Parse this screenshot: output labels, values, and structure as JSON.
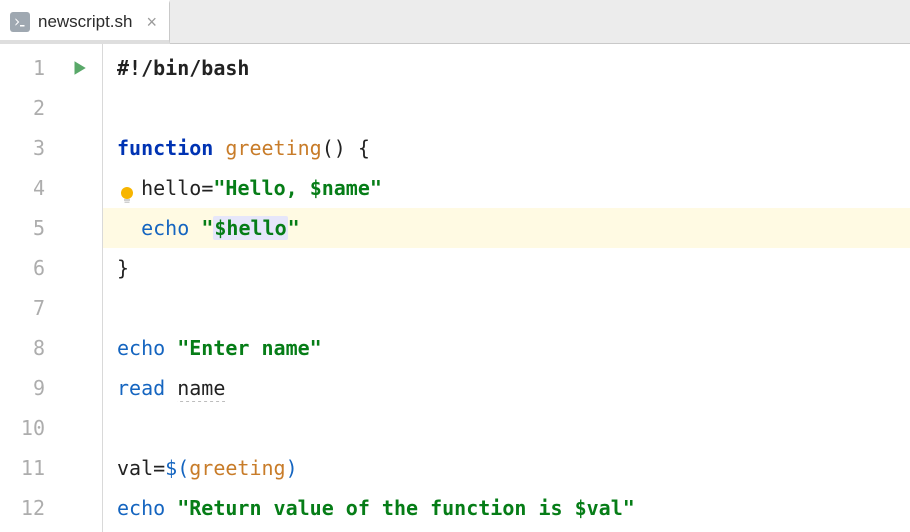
{
  "tab": {
    "filename": "newscript.sh",
    "close_glyph": "×"
  },
  "gutter": {
    "lines": [
      "1",
      "2",
      "3",
      "4",
      "5",
      "6",
      "7",
      "8",
      "9",
      "10",
      "11",
      "12"
    ]
  },
  "code": {
    "l1_shebang": "#!/bin/bash",
    "l3_kw": "function",
    "l3_fn": "greeting",
    "l3_paren": "()",
    "l3_brace": "{",
    "l4_var": "hello",
    "l4_eq": "=",
    "l4_str_open": "\"Hello, ",
    "l4_str_var": "$name",
    "l4_str_close": "\"",
    "l5_cmd": "echo",
    "l5_q1": "\"",
    "l5_var": "$hello",
    "l5_q2": "\"",
    "l6_brace": "}",
    "l8_cmd": "echo",
    "l8_str": "\"Enter name\"",
    "l9_cmd": "read",
    "l9_arg": "name",
    "l11_var": "val",
    "l11_eq": "=",
    "l11_dopen": "$(",
    "l11_call": "greeting",
    "l11_dclose": ")",
    "l12_cmd": "echo",
    "l12_str_open": "\"Return value of the function is ",
    "l12_str_var": "$val",
    "l12_str_close": "\""
  }
}
